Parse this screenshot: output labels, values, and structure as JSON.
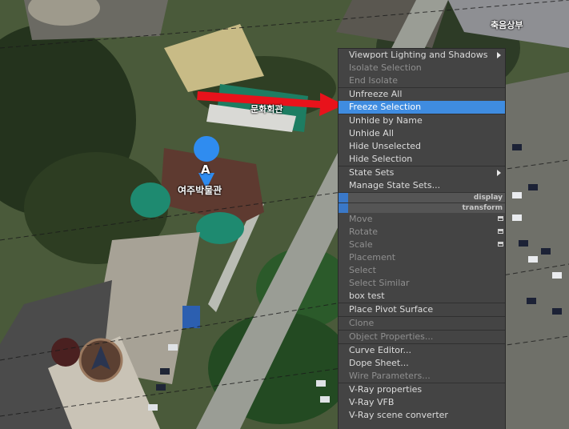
{
  "map": {
    "labels": {
      "top_right": "축음상부",
      "building_green": "문화회관",
      "building_main": "여주박물관",
      "pin_letter": "A"
    }
  },
  "context_menu": {
    "items": [
      {
        "label": "Viewport Lighting and Shadows",
        "state": "normal",
        "submenu": true
      },
      {
        "label": "Isolate Selection",
        "state": "disabled"
      },
      {
        "label": "End Isolate",
        "state": "disabled"
      },
      {
        "label": "Unfreeze All",
        "state": "normal"
      },
      {
        "label": "Freeze Selection",
        "state": "highlighted"
      },
      {
        "label": "Unhide by Name",
        "state": "normal"
      },
      {
        "label": "Unhide All",
        "state": "normal"
      },
      {
        "label": "Hide Unselected",
        "state": "normal"
      },
      {
        "label": "Hide Selection",
        "state": "normal"
      },
      {
        "label": "State Sets",
        "state": "normal",
        "submenu": true
      },
      {
        "label": "Manage State Sets...",
        "state": "normal"
      },
      {
        "label": "Move",
        "state": "disabled",
        "icon": "settings-box-icon"
      },
      {
        "label": "Rotate",
        "state": "disabled",
        "icon": "settings-box-icon"
      },
      {
        "label": "Scale",
        "state": "disabled",
        "icon": "settings-box-icon"
      },
      {
        "label": "Placement",
        "state": "disabled"
      },
      {
        "label": "Select",
        "state": "disabled"
      },
      {
        "label": "Select Similar",
        "state": "disabled"
      },
      {
        "label": "box test",
        "state": "normal"
      },
      {
        "label": "Place Pivot Surface",
        "state": "normal"
      },
      {
        "label": "Clone",
        "state": "disabled"
      },
      {
        "label": "Object Properties...",
        "state": "disabled"
      },
      {
        "label": "Curve Editor...",
        "state": "normal"
      },
      {
        "label": "Dope Sheet...",
        "state": "normal"
      },
      {
        "label": "Wire Parameters...",
        "state": "disabled"
      },
      {
        "label": "V-Ray properties",
        "state": "normal"
      },
      {
        "label": "V-Ray VFB",
        "state": "normal"
      },
      {
        "label": "V-Ray scene converter",
        "state": "normal"
      }
    ],
    "quad_headers": {
      "display": "display",
      "transform": "transform"
    }
  },
  "colors": {
    "menu_bg": "#444444",
    "highlight": "#3f8ce0",
    "annotation_arrow": "#e8121b",
    "pin": "#2f8cf0"
  }
}
